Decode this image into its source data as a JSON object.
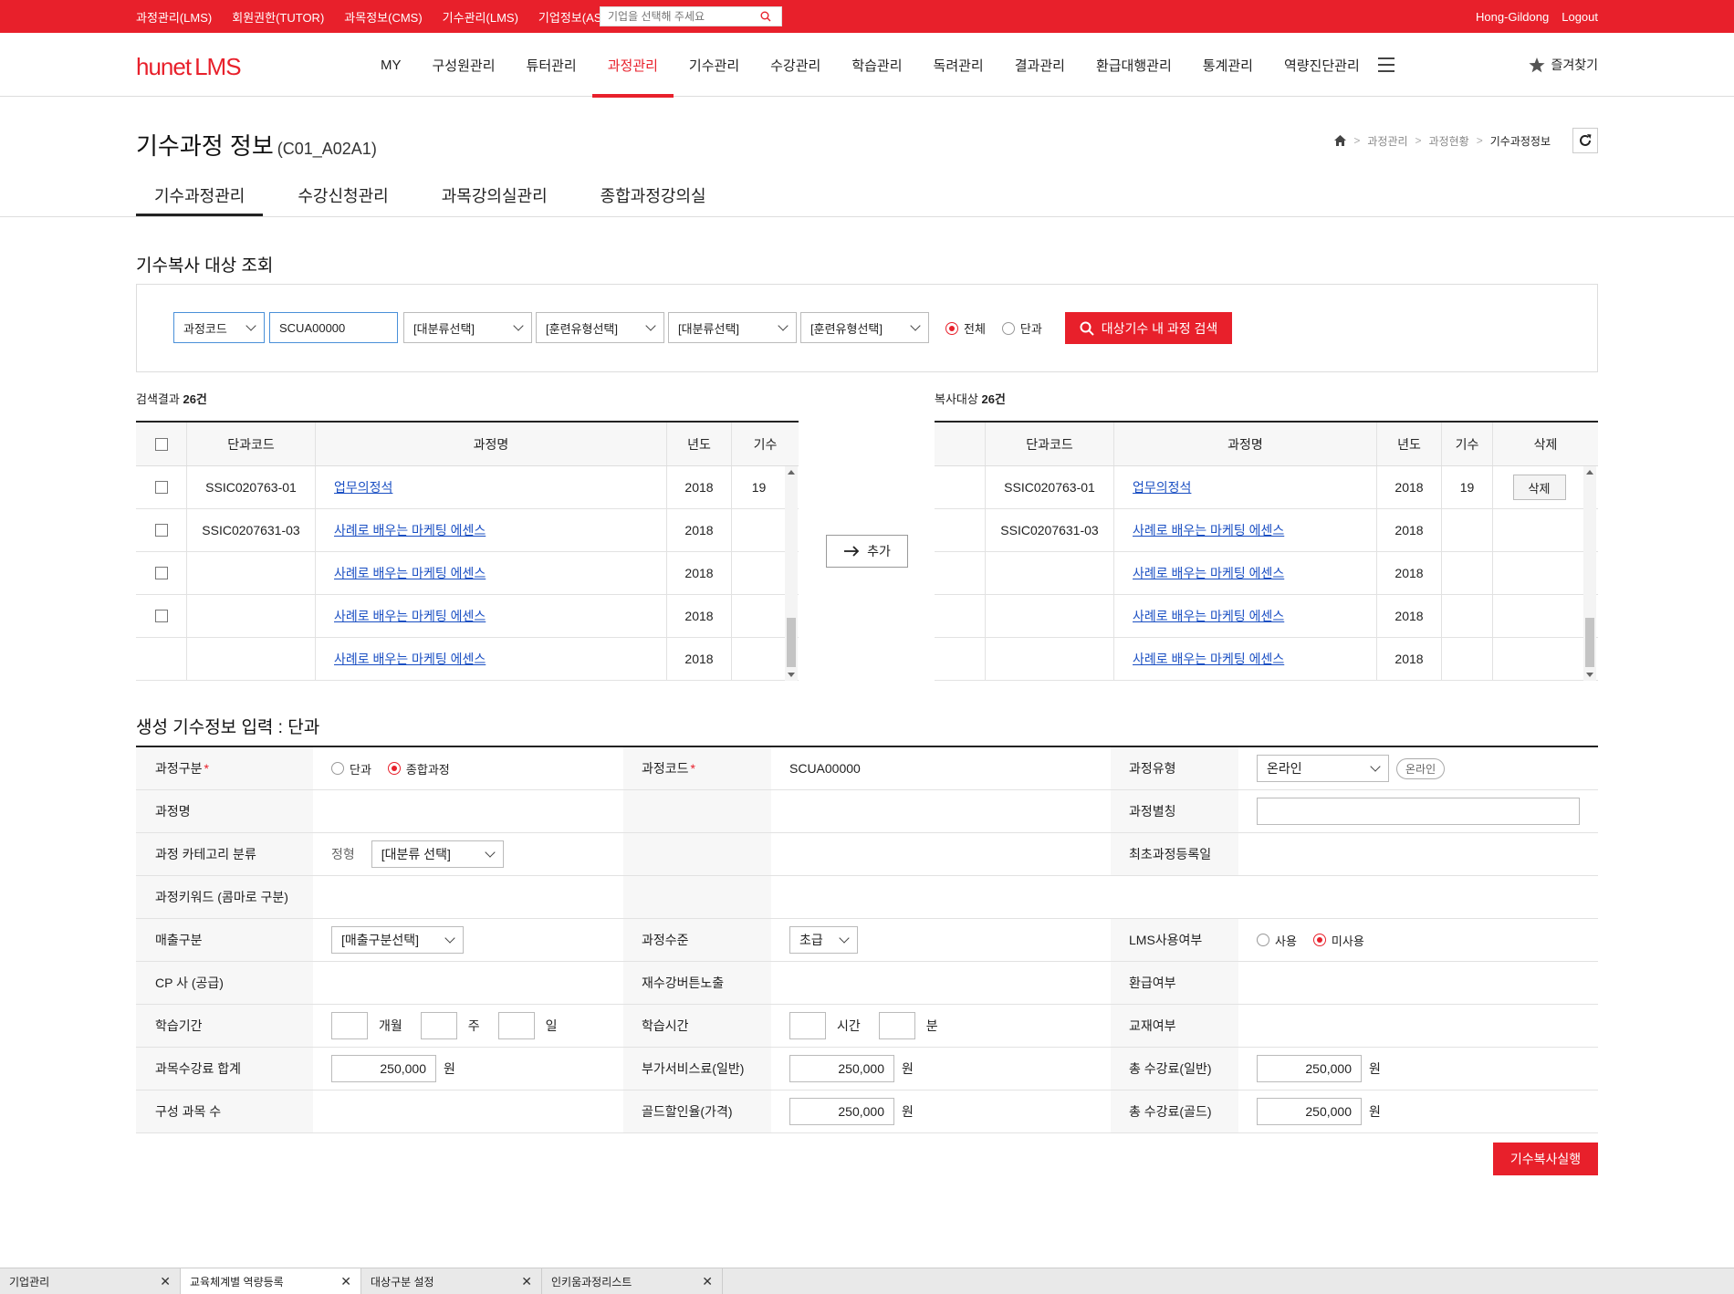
{
  "topbar": {
    "links": [
      "과정관리(LMS)",
      "회원권한(TUTOR)",
      "과목정보(CMS)",
      "기수관리(LMS)",
      "기업정보(ASP)"
    ],
    "search_placeholder": "기업을 선택해 주세요",
    "user": "Hong-Gildong",
    "logout": "Logout",
    "color": "#e8202b"
  },
  "gnb": {
    "logo_brand": "hunet",
    "logo_product": "LMS",
    "menu": [
      "MY",
      "구성원관리",
      "튜터관리",
      "과정관리",
      "기수관리",
      "수강관리",
      "학습관리",
      "독려관리",
      "결과관리",
      "환급대행관리",
      "통계관리",
      "역량진단관리"
    ],
    "active_index": 3,
    "favorite": "즐겨찾기"
  },
  "page": {
    "title": "기수과정 정보",
    "code": "(C01_A02A1)",
    "breadcrumb": [
      "과정관리",
      "과정현황",
      "기수과정정보"
    ],
    "tabs": [
      "기수과정관리",
      "수강신청관리",
      "과목강의실관리",
      "종합과정강의실"
    ],
    "active_tab": 0
  },
  "search": {
    "section_title": "기수복사 대상 조회",
    "code_type": "과정코드",
    "code_value": "SCUA00000",
    "select1": "[대분류선택]",
    "select2": "[훈련유형선택]",
    "select3": "[대분류선택]",
    "select4": "[훈련유형선택]",
    "radio_all": "전체",
    "radio_single": "단과",
    "button": "대상기수 내 과정 검색"
  },
  "results": {
    "count_label": "검색결과",
    "count": "26건",
    "columns": [
      "단과코드",
      "과정명",
      "년도",
      "기수"
    ],
    "rows": [
      {
        "code": "SSIC020763-01",
        "name": "업무의정석",
        "year": "2018",
        "gen": "19",
        "checkbox": true
      },
      {
        "code": "SSIC0207631-03",
        "name": "사례로 배우는 마케팅 에센스",
        "year": "2018",
        "gen": "",
        "checkbox": true
      },
      {
        "code": "",
        "name": "사례로 배우는 마케팅 에센스",
        "year": "2018",
        "gen": "",
        "checkbox": true
      },
      {
        "code": "",
        "name": "사례로 배우는 마케팅 에센스",
        "year": "2018",
        "gen": "",
        "checkbox": true
      },
      {
        "code": "",
        "name": "사례로 배우는 마케팅 에센스",
        "year": "2018",
        "gen": "",
        "checkbox": false
      }
    ]
  },
  "add_button": "추가",
  "copy": {
    "count_label": "복사대상",
    "count": "26건",
    "columns": [
      "단과코드",
      "과정명",
      "년도",
      "기수",
      "삭제"
    ],
    "delete_label": "삭제",
    "rows": [
      {
        "code": "SSIC020763-01",
        "name": "업무의정석",
        "year": "2018",
        "gen": "19",
        "delete": true
      },
      {
        "code": "SSIC0207631-03",
        "name": "사례로 배우는 마케팅 에센스",
        "year": "2018",
        "gen": "",
        "delete": false
      },
      {
        "code": "",
        "name": "사례로 배우는 마케팅 에센스",
        "year": "2018",
        "gen": "",
        "delete": false
      },
      {
        "code": "",
        "name": "사례로 배우는 마케팅 에센스",
        "year": "2018",
        "gen": "",
        "delete": false
      },
      {
        "code": "",
        "name": "사례로 배우는 마케팅 에센스",
        "year": "2018",
        "gen": "",
        "delete": false
      }
    ]
  },
  "form": {
    "section_title": "생성 기수정보 입력 : 단과",
    "course_type_label": "과정구분",
    "course_type_opt1": "단과",
    "course_type_opt2": "종합과정",
    "course_code_label": "과정코드",
    "course_code_value": "SCUA00000",
    "course_kind_label": "과정유형",
    "course_kind_value": "온라인",
    "course_kind_pill": "온라인",
    "course_name_label": "과정명",
    "course_alias_label": "과정별칭",
    "category_label": "과정 카테고리 분류",
    "category_prefix": "정형",
    "category_value": "[대분류 선택]",
    "first_reg_label": "최초과정등록일",
    "keyword_label": "과정키워드 (콤마로 구분)",
    "sales_label": "매출구분",
    "sales_value": "[매출구분선택]",
    "level_label": "과정수준",
    "level_value": "초급",
    "lms_label": "LMS사용여부",
    "lms_opt1": "사용",
    "lms_opt2": "미사용",
    "cp_label": "CP 사 (공급)",
    "retake_label": "재수강버튼노출",
    "refund_label": "환급여부",
    "period_label": "학습기간",
    "period_month": "개월",
    "period_week": "주",
    "period_day": "일",
    "time_label": "학습시간",
    "time_hour": "시간",
    "time_min": "분",
    "textbook_label": "교재여부",
    "fee_sum_label": "과목수강료 합계",
    "fee_sum_value": "250,000",
    "vat_label": "부가서비스료(일반)",
    "vat_value": "250,000",
    "total_label": "총 수강료(일반)",
    "total_value": "250,000",
    "count_label": "구성 과목 수",
    "gold_label": "골드할인율(가격)",
    "gold_value": "250,000",
    "total_gold_label": "총 수강료(골드)",
    "total_gold_value": "250,000",
    "won": "원",
    "submit": "기수복사실행"
  },
  "bottom_tabs": [
    "기업관리",
    "교육체계별 역량등록",
    "대상구분 설정",
    "인키움과정리스트"
  ],
  "bottom_active": 1
}
